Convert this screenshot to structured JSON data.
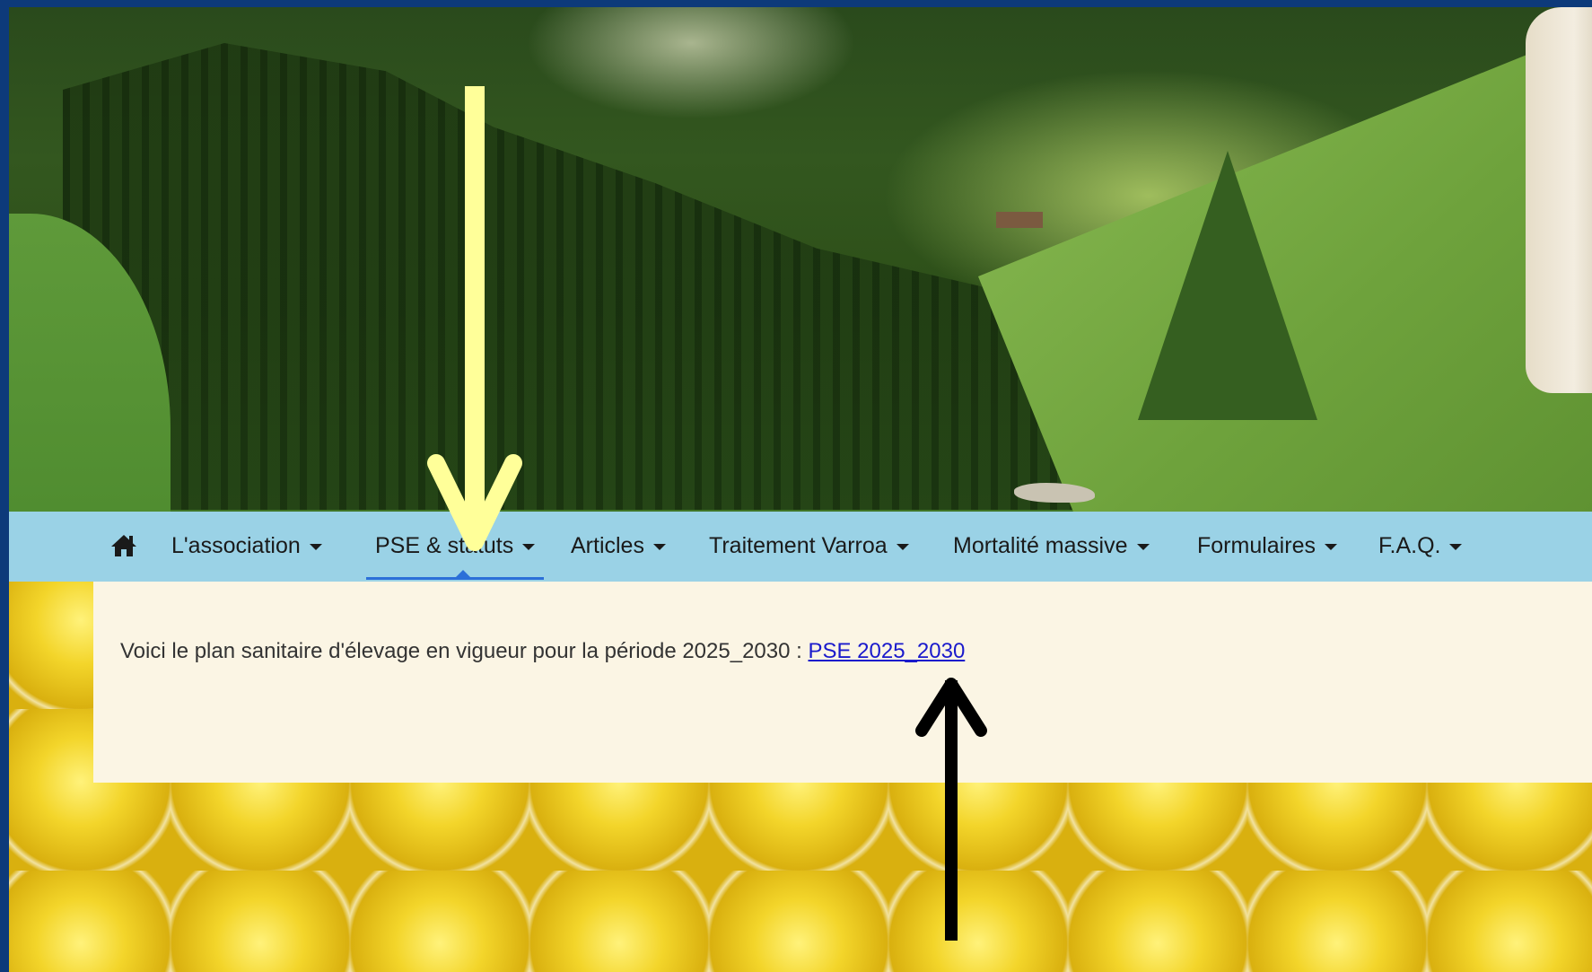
{
  "nav": {
    "home_icon": "home-icon",
    "items": [
      {
        "label": "L'association"
      },
      {
        "label": "PSE & statuts"
      },
      {
        "label": "Articles"
      },
      {
        "label": "Traitement Varroa"
      },
      {
        "label": "Mortalité massive"
      },
      {
        "label": "Formulaires"
      },
      {
        "label": "F.A.Q."
      }
    ],
    "active": "PSE & statuts",
    "background_color": "#9ad2e6",
    "active_underline_color": "#2b6fd8"
  },
  "content": {
    "text": "Voici le plan sanitaire d'élevage en vigueur pour la période 2025_2030 : ",
    "link_label": "PSE 2025_2030"
  },
  "annotations": {
    "arrow_top_color": "#ffff99",
    "arrow_bottom_color": "#000000"
  },
  "colors": {
    "frame_border": "#0d3a7a",
    "panel_background": "#fbf5e4"
  }
}
